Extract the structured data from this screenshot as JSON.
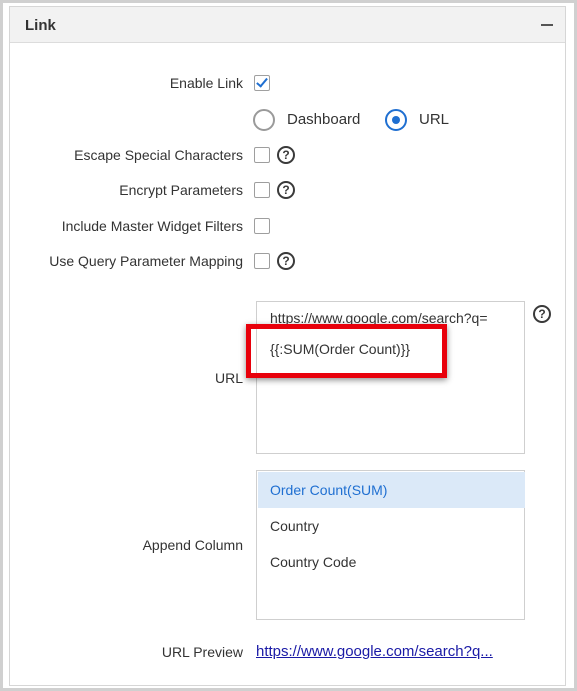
{
  "panel": {
    "title": "Link"
  },
  "form": {
    "enable_link": {
      "label": "Enable Link",
      "checked": true
    },
    "link_type": {
      "options": [
        {
          "label": "Dashboard",
          "selected": false
        },
        {
          "label": "URL",
          "selected": true
        }
      ]
    },
    "escape_special_characters": {
      "label": "Escape Special Characters",
      "checked": false
    },
    "encrypt_parameters": {
      "label": "Encrypt Parameters",
      "checked": false
    },
    "include_master_widget_filters": {
      "label": "Include Master Widget Filters",
      "checked": false
    },
    "use_query_parameter_mapping": {
      "label": "Use Query Parameter Mapping",
      "checked": false
    },
    "url": {
      "label": "URL",
      "value_line1": "https://www.google.com/search?q=",
      "value_line2": "{{:SUM(Order Count)}}"
    },
    "append_column": {
      "label": "Append Column",
      "items": [
        {
          "label": "Order Count(SUM)",
          "selected": true
        },
        {
          "label": "Country",
          "selected": false
        },
        {
          "label": "Country Code",
          "selected": false
        }
      ]
    },
    "url_preview": {
      "label": "URL Preview",
      "value": "https://www.google.com/search?q..."
    }
  },
  "icons": {
    "help": "?"
  },
  "colors": {
    "accent": "#1f6fd1",
    "highlight_box": "#e8000b",
    "selected_row_bg": "#dbe9f8",
    "link": "#1a1aa6"
  }
}
